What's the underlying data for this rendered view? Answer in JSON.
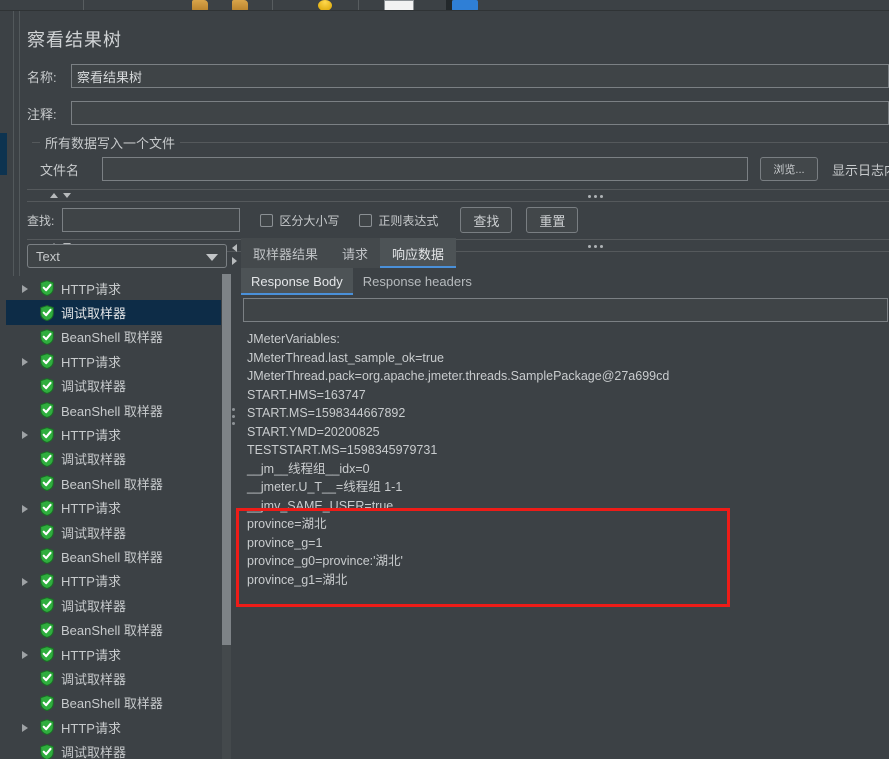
{
  "window": {
    "title": "察看结果树"
  },
  "toolbar": {
    "icons": [
      "folder-open-icon",
      "folder-icon",
      "bulb-icon",
      "page-white-icon",
      "blue-bar-icon"
    ]
  },
  "form": {
    "name_label": "名称:",
    "name_value": "察看结果树",
    "comment_label": "注释:",
    "comment_value": ""
  },
  "write_group": {
    "title": "所有数据写入一个文件",
    "filename_label": "文件名",
    "filename_value": "",
    "browse_label": "浏览...",
    "log_label": "显示日志内容:"
  },
  "search": {
    "label": "查找:",
    "value": "",
    "case_sensitive_label": "区分大小写",
    "regex_label": "正则表达式",
    "find_button": "查找",
    "reset_button": "重置"
  },
  "renderer": {
    "selected": "Text"
  },
  "tree": {
    "items": [
      {
        "label": "HTTP请求",
        "expandable": true,
        "selected": false
      },
      {
        "label": "调试取样器",
        "expandable": false,
        "selected": true
      },
      {
        "label": "BeanShell 取样器",
        "expandable": false,
        "selected": false
      },
      {
        "label": "HTTP请求",
        "expandable": true,
        "selected": false
      },
      {
        "label": "调试取样器",
        "expandable": false,
        "selected": false
      },
      {
        "label": "BeanShell 取样器",
        "expandable": false,
        "selected": false
      },
      {
        "label": "HTTP请求",
        "expandable": true,
        "selected": false
      },
      {
        "label": "调试取样器",
        "expandable": false,
        "selected": false
      },
      {
        "label": "BeanShell 取样器",
        "expandable": false,
        "selected": false
      },
      {
        "label": "HTTP请求",
        "expandable": true,
        "selected": false
      },
      {
        "label": "调试取样器",
        "expandable": false,
        "selected": false
      },
      {
        "label": "BeanShell 取样器",
        "expandable": false,
        "selected": false
      },
      {
        "label": "HTTP请求",
        "expandable": true,
        "selected": false
      },
      {
        "label": "调试取样器",
        "expandable": false,
        "selected": false
      },
      {
        "label": "BeanShell 取样器",
        "expandable": false,
        "selected": false
      },
      {
        "label": "HTTP请求",
        "expandable": true,
        "selected": false
      },
      {
        "label": "调试取样器",
        "expandable": false,
        "selected": false
      },
      {
        "label": "BeanShell 取样器",
        "expandable": false,
        "selected": false
      },
      {
        "label": "HTTP请求",
        "expandable": true,
        "selected": false
      },
      {
        "label": "调试取样器",
        "expandable": false,
        "selected": false
      }
    ]
  },
  "results": {
    "tabs": [
      {
        "label": "取样器结果",
        "active": false
      },
      {
        "label": "请求",
        "active": false
      },
      {
        "label": "响应数据",
        "active": true
      }
    ],
    "subtabs": [
      {
        "label": "Response Body",
        "active": true
      },
      {
        "label": "Response headers",
        "active": false
      }
    ],
    "search_value": "",
    "body_lines": [
      "JMeterVariables:",
      "JMeterThread.last_sample_ok=true",
      "JMeterThread.pack=org.apache.jmeter.threads.SamplePackage@27a699cd",
      "START.HMS=163747",
      "START.MS=1598344667892",
      "START.YMD=20200825",
      "TESTSTART.MS=1598345979731",
      "__jm__线程组__idx=0",
      "__jmeter.U_T__=线程组 1-1",
      "__jmv_SAME_USER=true",
      "province=湖北",
      "province_g=1",
      "province_g0=province:'湖北'",
      "province_g1=湖北"
    ]
  },
  "annotation": {
    "box_color": "#EE1C18",
    "highlighted_lines": [
      "province=湖北",
      "province_g=1",
      "province_g0=province:'湖北'",
      "province_g1=湖北"
    ]
  },
  "theme": {
    "background": "#3C4145",
    "panel": "#44494C",
    "accent": "#4A90D9",
    "selection": "#0D2C47",
    "text": "#C7CACC",
    "icon_green": "#2FAE3E"
  }
}
